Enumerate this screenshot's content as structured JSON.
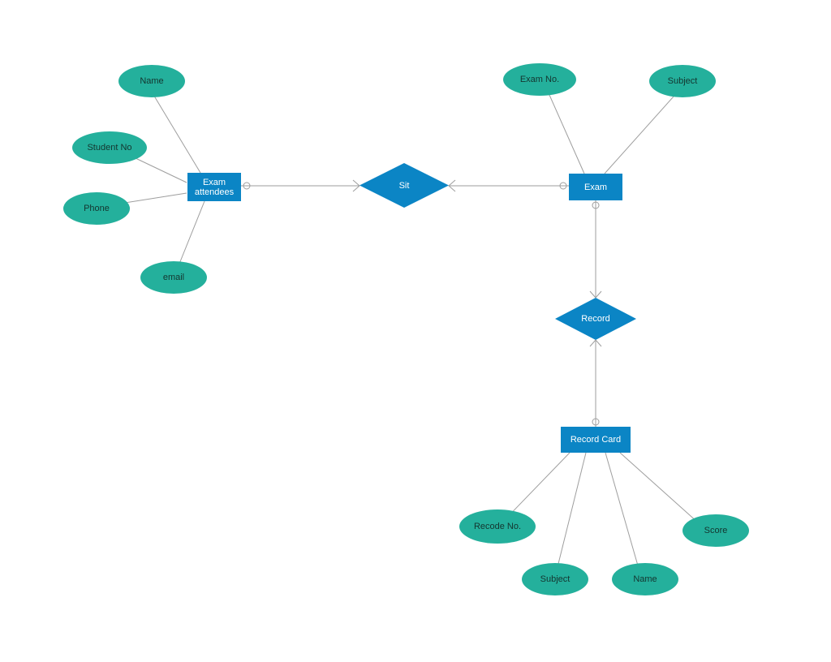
{
  "entities": {
    "examAttendees": "Exam attendees",
    "exam": "Exam",
    "recordCard": "Record Card"
  },
  "relationships": {
    "sit": "Sit",
    "record": "Record"
  },
  "attributes": {
    "name1": "Name",
    "studentNo": "Student No",
    "phone": "Phone",
    "email": "email",
    "examNo": "Exam No.",
    "subject1": "Subject",
    "recodeNo": "Recode No.",
    "subject2": "Subject",
    "name2": "Name",
    "score": "Score"
  },
  "colors": {
    "entity": "#0b85c5",
    "attribute": "#24b09c",
    "line": "#9e9e9e"
  }
}
